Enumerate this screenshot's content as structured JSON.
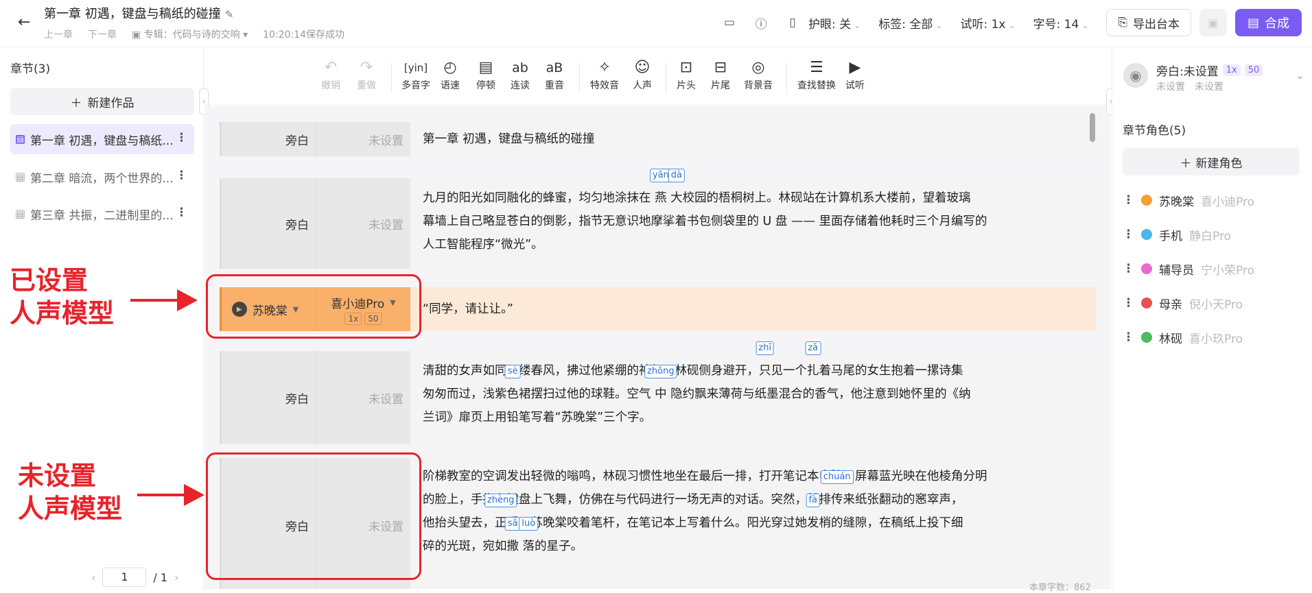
{
  "header": {
    "title": "第一章 初遇，键盘与稿纸的碰撞",
    "prev": "上一章",
    "next": "下一章",
    "album": "专辑：代码与诗的交响",
    "save_status": "10:20:14保存成功",
    "eye": "护眼: 关",
    "tags": "标签: 全部",
    "listen": "试听: 1x",
    "fontsize": "字号: 14",
    "export": "导出台本",
    "synth": "合成"
  },
  "left": {
    "title": "章节(3)",
    "new_work": "新建作品",
    "chapters": [
      "第一章 初遇，键盘与稿纸...",
      "第二章 暗流，两个世界的...",
      "第三章 共振，二进制里的..."
    ],
    "page": "1",
    "total": "/ 1"
  },
  "toolbar": {
    "undo": "撤销",
    "redo": "重做",
    "polyphone": "多音字",
    "speed": "语速",
    "pause": "停顿",
    "liaison": "连读",
    "stress": "重音",
    "effect": "特效音",
    "voice": "人声",
    "intro": "片头",
    "outro": "片尾",
    "bgm": "背景音",
    "find": "查找替换",
    "preview": "试听"
  },
  "rows": {
    "r1": {
      "role": "旁白",
      "voice": "未设置",
      "text": "第一章 初遇，键盘与稿纸的碰撞"
    },
    "r2": {
      "role": "旁白",
      "voice": "未设置",
      "t1": "九月的阳光如同融化的蜂蜜，均匀地涂抹在",
      "w1": "燕",
      "p1": "yān",
      "w2": "大",
      "p2": "dà",
      "t2": "校园的梧桐树上。林砚站在计算机系大楼前，望着玻璃",
      "t3": "幕墙上自己略显苍白的倒影，指节无意识地摩挲着书包侧袋里的 U 盘 —— 里面存储着他耗时三个月编写的",
      "t4": "人工智能程序“微光”。"
    },
    "r3": {
      "role": "苏晚棠",
      "voice": "喜小迪Pro",
      "speed": "1x",
      "vol": "50",
      "text": "“同学，请让让。”"
    },
    "r4": {
      "role": "旁白",
      "voice": "未设置",
      "a1": "清甜的女声如同一缕春风，拂过他紧绷的神经。林砚侧身避开，",
      "w1": "只",
      "p1": "zhī",
      "a2": "见一个",
      "w2": "扎",
      "p2": "zā",
      "a3": "着马尾的女生抱着一摞诗集",
      "b1": "匆匆而过，浅紫",
      "w3": "色",
      "p3": "sè",
      "b2": "裙摆扫过他的球鞋。空气",
      "w4": "中",
      "p4": "zhōng",
      "b3": "隐约飘来薄荷与纸墨混合的香气，他注意到她怀里的《纳",
      "c1": "兰词》扉页上用铅笔写着“苏晚棠”三个字。"
    },
    "r5": {
      "role": "旁白",
      "voice": "未设置",
      "a1": "阶梯教室的空调发出轻微的嗡鸣，林砚习惯性地坐在最后一排，打开笔记本电脑。屏幕蓝光映在他棱角分明",
      "b1": "的脸上，手指在键盘上飞舞，仿佛在与代码进行一场无声的对话。突然，前排",
      "w1": "传",
      "p1": "chuán",
      "b2": "来纸张翻动的窸窣声，",
      "c1": "他抬头望去，",
      "w2": "正",
      "p2": "zhèng",
      "c2": "看见苏晚棠咬着笔杆，在笔记本上写着什么。阳光穿过她",
      "w3": "发",
      "p3": "fà",
      "c3": "梢的缝隙，在稿纸上投下细",
      "d1": "碎的光斑，宛如",
      "w4": "撒",
      "p4": "sǎ",
      "w5": "落",
      "p5": "luò",
      "d2": "的星子。"
    }
  },
  "word_count": "本章字数：862",
  "right": {
    "narrator": "旁白:未设置",
    "speed": "1x",
    "vol": "50",
    "sub1": "未设置",
    "sub2": "未设置",
    "roles_title": "章节角色(5)",
    "new_role": "新建角色",
    "roles": [
      {
        "name": "苏晚棠",
        "model": "喜小迪Pro",
        "color": "#f5a032"
      },
      {
        "name": "手机",
        "model": "静白Pro",
        "color": "#4db6e8"
      },
      {
        "name": "辅导员",
        "model": "宁小荣Pro",
        "color": "#e86bd0"
      },
      {
        "name": "母亲",
        "model": "倪小天Pro",
        "color": "#e85050"
      },
      {
        "name": "林砚",
        "model": "喜小玖Pro",
        "color": "#4cbb5a"
      }
    ]
  },
  "annotations": {
    "set": "已设置\n人声模型",
    "unset": "未设置\n人声模型"
  }
}
